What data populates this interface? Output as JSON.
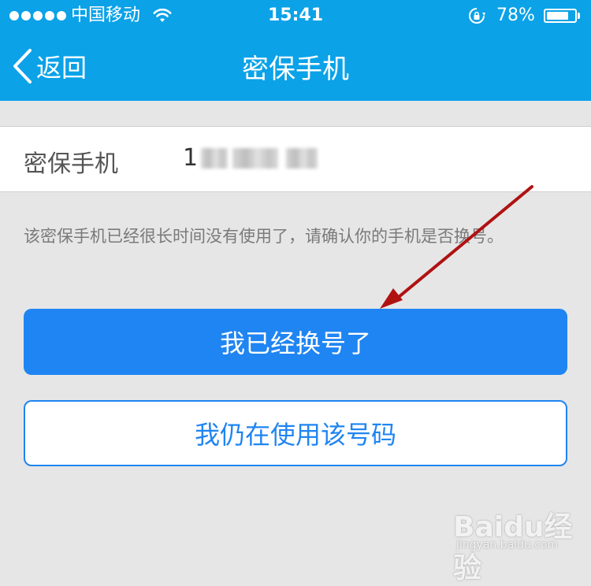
{
  "status_bar": {
    "carrier": "中国移动",
    "time": "15:41",
    "battery_pct": "78%",
    "battery_level": 0.78,
    "signal_bars_filled": 5
  },
  "nav": {
    "back_label": "返回",
    "title": "密保手机"
  },
  "phone_row": {
    "label": "密保手机",
    "value_visible_prefix": "1"
  },
  "hint": "该密保手机已经很长时间没有使用了，请确认你的手机是否换号。",
  "buttons": {
    "changed_label": "我已经换号了",
    "still_using_label": "我仍在使用该号码"
  },
  "watermark": {
    "logo": "Baidu经验",
    "site": "jingyan.baidu.com"
  },
  "colors": {
    "header_bg": "#0ba2e8",
    "primary_button": "#1f85f2",
    "annotation_arrow": "#b01212"
  }
}
